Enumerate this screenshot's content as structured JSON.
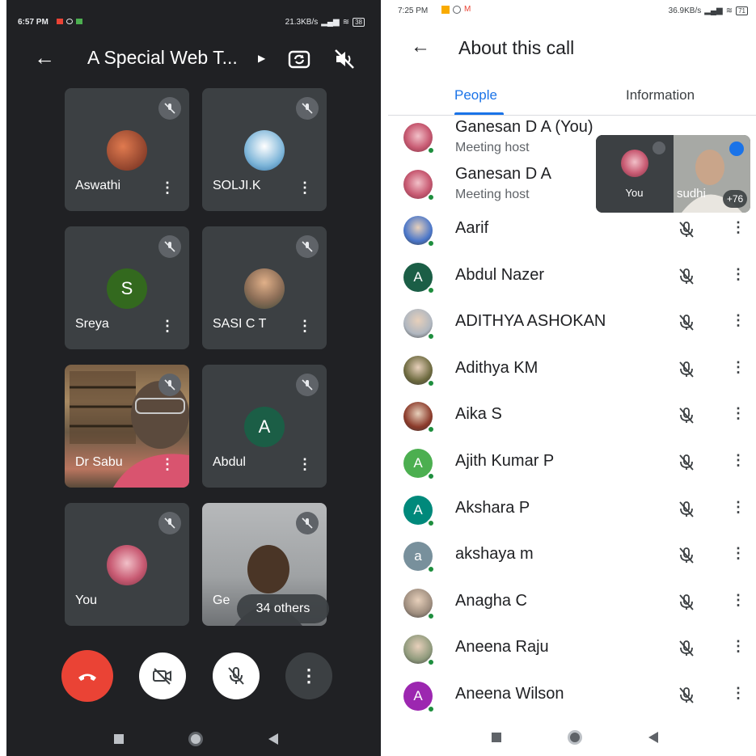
{
  "left_phone": {
    "status": {
      "time": "6:57 PM",
      "net_speed": "21.3KB/s",
      "battery": "38"
    },
    "title": "A Special Web T...",
    "tiles": [
      {
        "name": "Aswathi",
        "avatar": "photo",
        "color": "#b5472e"
      },
      {
        "name": "SOLJI.K",
        "avatar": "photo",
        "color": "#7fb6d9"
      },
      {
        "name": "Sreya",
        "avatar": "S",
        "color": "#33691e"
      },
      {
        "name": "SASI C T",
        "avatar": "photo",
        "color": "#8d6e57"
      },
      {
        "name": "Dr Sabu",
        "avatar": "video",
        "color": "#7a6b55"
      },
      {
        "name": "Abdul",
        "avatar": "A",
        "color": "#1b5e46"
      },
      {
        "name": "You",
        "avatar": "photo",
        "color": "#c95c74"
      },
      {
        "name": "Ge",
        "avatar": "video",
        "color": "#9b9ea0"
      }
    ],
    "others_badge": "34 others",
    "controls": [
      "end-call",
      "camera-off",
      "mic-off",
      "more"
    ],
    "colors": {
      "end_call": "#ea4335",
      "bg": "#202124",
      "tile": "#3c4043"
    }
  },
  "right_phone": {
    "status": {
      "time": "7:25 PM",
      "net_speed": "36.9KB/s",
      "battery": "71"
    },
    "title": "About this call",
    "tabs": [
      {
        "label": "People",
        "active": true
      },
      {
        "label": "Information",
        "active": false
      }
    ],
    "hosts": [
      {
        "name": "Ganesan D A (You)",
        "role": "Meeting host"
      },
      {
        "name": "Ganesan D A",
        "role": "Meeting host"
      }
    ],
    "pip": {
      "self_label": "You",
      "other_label": "sudhi",
      "extra_count": "+76"
    },
    "people": [
      {
        "name": "Aarif",
        "avatar": "photo",
        "color": "#4a76c9",
        "letter": ""
      },
      {
        "name": "Abdul Nazer",
        "avatar": "letter",
        "color": "#1b5e46",
        "letter": "A"
      },
      {
        "name": "ADITHYA ASHOKAN",
        "avatar": "photo",
        "color": "#b0b7c0",
        "letter": ""
      },
      {
        "name": "Adithya KM",
        "avatar": "photo",
        "color": "#6d6a3f",
        "letter": ""
      },
      {
        "name": "Aika S",
        "avatar": "photo",
        "color": "#8b3a2a",
        "letter": ""
      },
      {
        "name": "Ajith Kumar P",
        "avatar": "letter",
        "color": "#4caf50",
        "letter": "A"
      },
      {
        "name": "Akshara P",
        "avatar": "letter",
        "color": "#00897b",
        "letter": "A"
      },
      {
        "name": "akshaya m",
        "avatar": "letter",
        "color": "#78909c",
        "letter": "a"
      },
      {
        "name": "Anagha C",
        "avatar": "photo",
        "color": "#9e8d7e",
        "letter": ""
      },
      {
        "name": "Aneena Raju",
        "avatar": "photo",
        "color": "#8f9a7c",
        "letter": ""
      },
      {
        "name": "Aneena Wilson",
        "avatar": "letter",
        "color": "#9c27b0",
        "letter": "A"
      }
    ]
  }
}
